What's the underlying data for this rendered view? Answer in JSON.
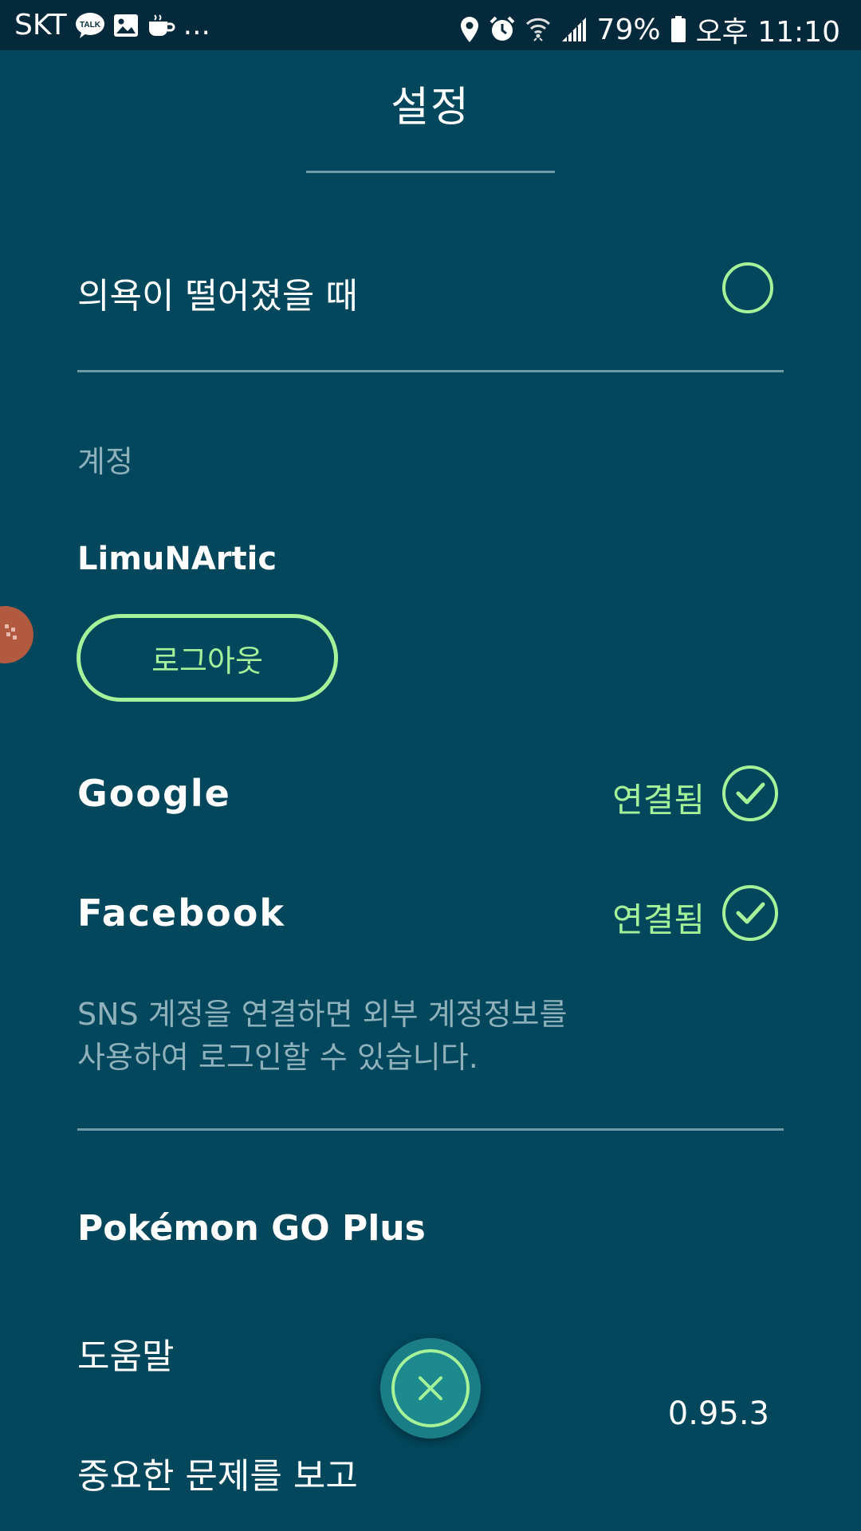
{
  "status_bar": {
    "carrier": "SKT",
    "more_indicator": "...",
    "battery_percent": "79%",
    "time": "오후 11:10",
    "icons_left": [
      "kakaotalk-icon",
      "gallery-icon",
      "coffee-icon"
    ],
    "icons_right": [
      "location-icon",
      "alarm-icon",
      "wifi-icon",
      "signal-icon",
      "battery-icon"
    ]
  },
  "header": {
    "title": "설정"
  },
  "settings": {
    "low_motivation_label": "의욕이 떨어졌을 때",
    "low_motivation_checked": false
  },
  "account": {
    "section_label": "계정",
    "username": "LimuNArtic",
    "logout_label": "로그아웃",
    "providers": [
      {
        "name": "Google",
        "status": "연결됨",
        "connected": true
      },
      {
        "name": "Facebook",
        "status": "연결됨",
        "connected": true
      }
    ],
    "sns_note_line1": "SNS 계정을 연결하면 외부 계정정보를",
    "sns_note_line2": "사용하여 로그인할 수 있습니다."
  },
  "menu": {
    "go_plus": "Pokémon GO Plus",
    "help": "도움말",
    "report": "중요한 문제를 보고",
    "version": "0.95.3"
  },
  "colors": {
    "background": "#03475c",
    "status_bar": "#03293a",
    "accent_green": "#a4f29a",
    "muted_text": "#8fb1bc",
    "divider": "#6f9aa8",
    "fab": "#1b7e86"
  }
}
